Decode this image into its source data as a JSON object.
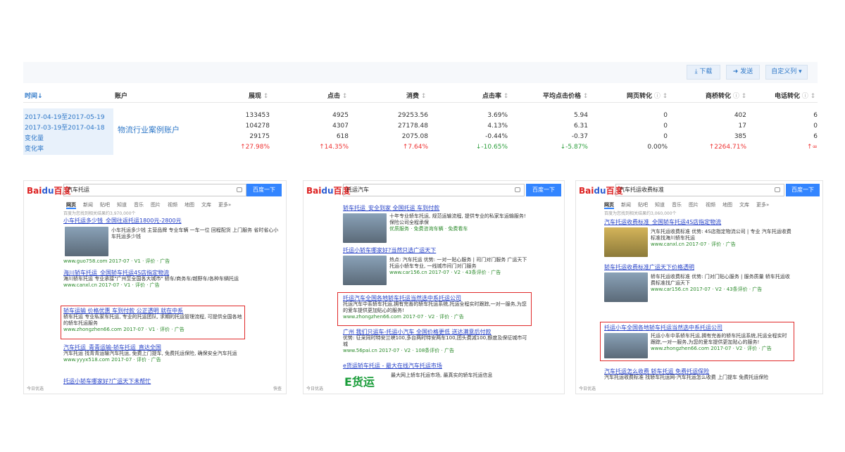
{
  "toolbar": {
    "download": "下载",
    "send": "发送",
    "custom": "自定义列"
  },
  "table": {
    "headers": {
      "time": "时间",
      "account": "账户",
      "impressions": "展现",
      "clicks": "点击",
      "cost": "消费",
      "ctr": "点击率",
      "cpc": "平均点击价格",
      "web": "网页转化",
      "biz": "商桥转化",
      "phone": "电话转化"
    },
    "account_name": "物流行业案例账户",
    "rows": [
      {
        "label": "2017-04-19至2017-05-19",
        "vals": [
          "133453",
          "4925",
          "29253.56",
          "3.69%",
          "5.94",
          "0",
          "402",
          "6"
        ]
      },
      {
        "label": "2017-03-19至2017-04-18",
        "vals": [
          "104278",
          "4307",
          "27178.48",
          "4.13%",
          "6.31",
          "0",
          "17",
          "0"
        ]
      },
      {
        "label": "变化量",
        "vals": [
          "29175",
          "618",
          "2075.08",
          "-0.44%",
          "-0.37",
          "0",
          "385",
          "6"
        ]
      },
      {
        "label": "变化率",
        "vals": [
          "↑27.98%",
          "↑14.35%",
          "↑7.64%",
          "↓-10.65%",
          "↓-5.87%",
          "0.00%",
          "↑2264.71%",
          "↑∞"
        ]
      }
    ]
  },
  "panels": [
    {
      "query": "汽车托运",
      "button": "百度一下",
      "stats": "百度为您找到相关结果约3,970,000个",
      "results": [
        {
          "title": "小车托运多少钱_全国往返托运1800元-2800元",
          "desc": "小车托运多少钱 主营品牌 专业车辆 一车一位 回程配货 上门服务 省时省心小车托运多少钱",
          "url": "www.guo758.com  2017-07 · V1 · 评价 · 广告"
        },
        {
          "title": "海川轿车托运_全国轿车托运4S店指定物流",
          "desc": "海川轿车托运 专业承接\"广州至全国各大城市\" 轿车/商务车/越野车/各种车辆托运",
          "url": "www.canxl.cn  2017-07 · V1 · 评价 · 广告"
        },
        {
          "title": "轿车运输 价格优惠 车到付款 公正透明 就在中系",
          "desc": "轿车托运 专业私家车托运, 专业的托运团队, 求期的托运管理流程, 可提供全国各地的轿车托运服务",
          "url": "www.zhongzhen66.com  2017-07 · V1 · 评价 · 广告"
        },
        {
          "title": "汽车托运_青青运输-轿车托运_直达全国",
          "desc": "汽车托运 找青青运输汽车托运, 免费上门提车, 免费托运保险, 确保安全汽车托运",
          "url": "www.yyyx518.com  2017-07 · 评价 · 广告"
        },
        {
          "title": "托运小轿车哪家好?广运天下未帮忙",
          "desc": "",
          "url": ""
        }
      ],
      "footer": "今日优选",
      "footer2": "快查"
    },
    {
      "query": "托运汽车",
      "button": "百度一下",
      "results": [
        {
          "title": "轿车托运_安全到家 全国托运 车到付款",
          "desc": "十年专业轿车托运, 规范运输流程, 提供专业的私家车运输服务! 保险公司全程承保",
          "url": "优质服务 · 免费咨询车辆 · 免费看车"
        },
        {
          "title": "托运小轿车哪家好?当然只选广运天下",
          "desc": "热点: 汽车托运 优势: 一对一贴心服务 | 司门对门服务 广运天下托运小轿车专业, 一线城市间门对门服务",
          "url": "www.car156.cn  2017-07 · V2 · 43条评价 · 广告"
        },
        {
          "title": "托运汽车全国各地轿车托运当然选中系托运公司",
          "desc": "托运汽车中系轿车托运,拥有完善的轿车托运系统,托运全程实时跟踪,一对一服务,为您的爱车提供更加贴心的服务!",
          "url": "www.zhongzhen66.com  2017-07 · V2 · 评价 · 广告"
        },
        {
          "title": "广州 我们只运车-托运小汽车 全国价格更低 送达满意后付款",
          "desc": "优势: 征采同时特安兰峡100,多台两时特安两车100,团头费减100,额度及保征城市可城",
          "url": "www.56pai.cn  2017-07 · V2 · 108条评价 · 广告"
        },
        {
          "title": "e货运轿车托运 - 最大在线汽车托运市场",
          "desc": "最大网上轿车托运市场, 最真实的轿车托运信息",
          "url": ""
        }
      ],
      "footer": "今日优选",
      "logo_text": "E货运"
    },
    {
      "query": "汽车托运收费标准",
      "button": "百度一下",
      "stats": "百度为您找到相关结果约3,060,000个",
      "results": [
        {
          "title": "汽车托运收费标准_全国轿车托运4S店指定物流",
          "desc": "汽车托运收费标准 优势: 4S店指定物流公司 | 专业 汽车托运收费标准找海川轿车托运",
          "url": "www.canxl.cn  2017-07 · 评价 · 广告"
        },
        {
          "title": "轿车托运收费标准广运天下价格透明",
          "desc": "轿车托运收费标准 优势: 门对门贴心服务 | 服务质量 轿车托运收费标准找广运天下",
          "url": "www.car156.cn  2017-07 · V2 · 43条评价 · 广告"
        },
        {
          "title": "托运小车全国各地轿车托运当然选中系托运公司",
          "desc": "托运小车中系轿车托运,拥有完善的轿车托运系统,托运全程实时跟踪,一对一服务,为您的爱车提供更加贴心的服务!",
          "url": "www.zhongzhen66.com  2017-07 · V2 · 评价 · 广告"
        },
        {
          "title": "汽车托运怎么收费 轿车托运 免费托运保险",
          "desc": "汽车托运收费标准 找轿车托运网-汽车托运怎么收费 上门提车 免费托运保险",
          "url": ""
        }
      ],
      "footer": "今日优选"
    }
  ],
  "tabs": [
    "网页",
    "新闻",
    "贴吧",
    "知道",
    "音乐",
    "图片",
    "视频",
    "地图",
    "文库",
    "更多»"
  ],
  "colors": {
    "link": "#2440c7",
    "accent": "#3385ff",
    "highlight": "#e02a2a",
    "up": "#e33",
    "down": "#2a9d3a"
  }
}
